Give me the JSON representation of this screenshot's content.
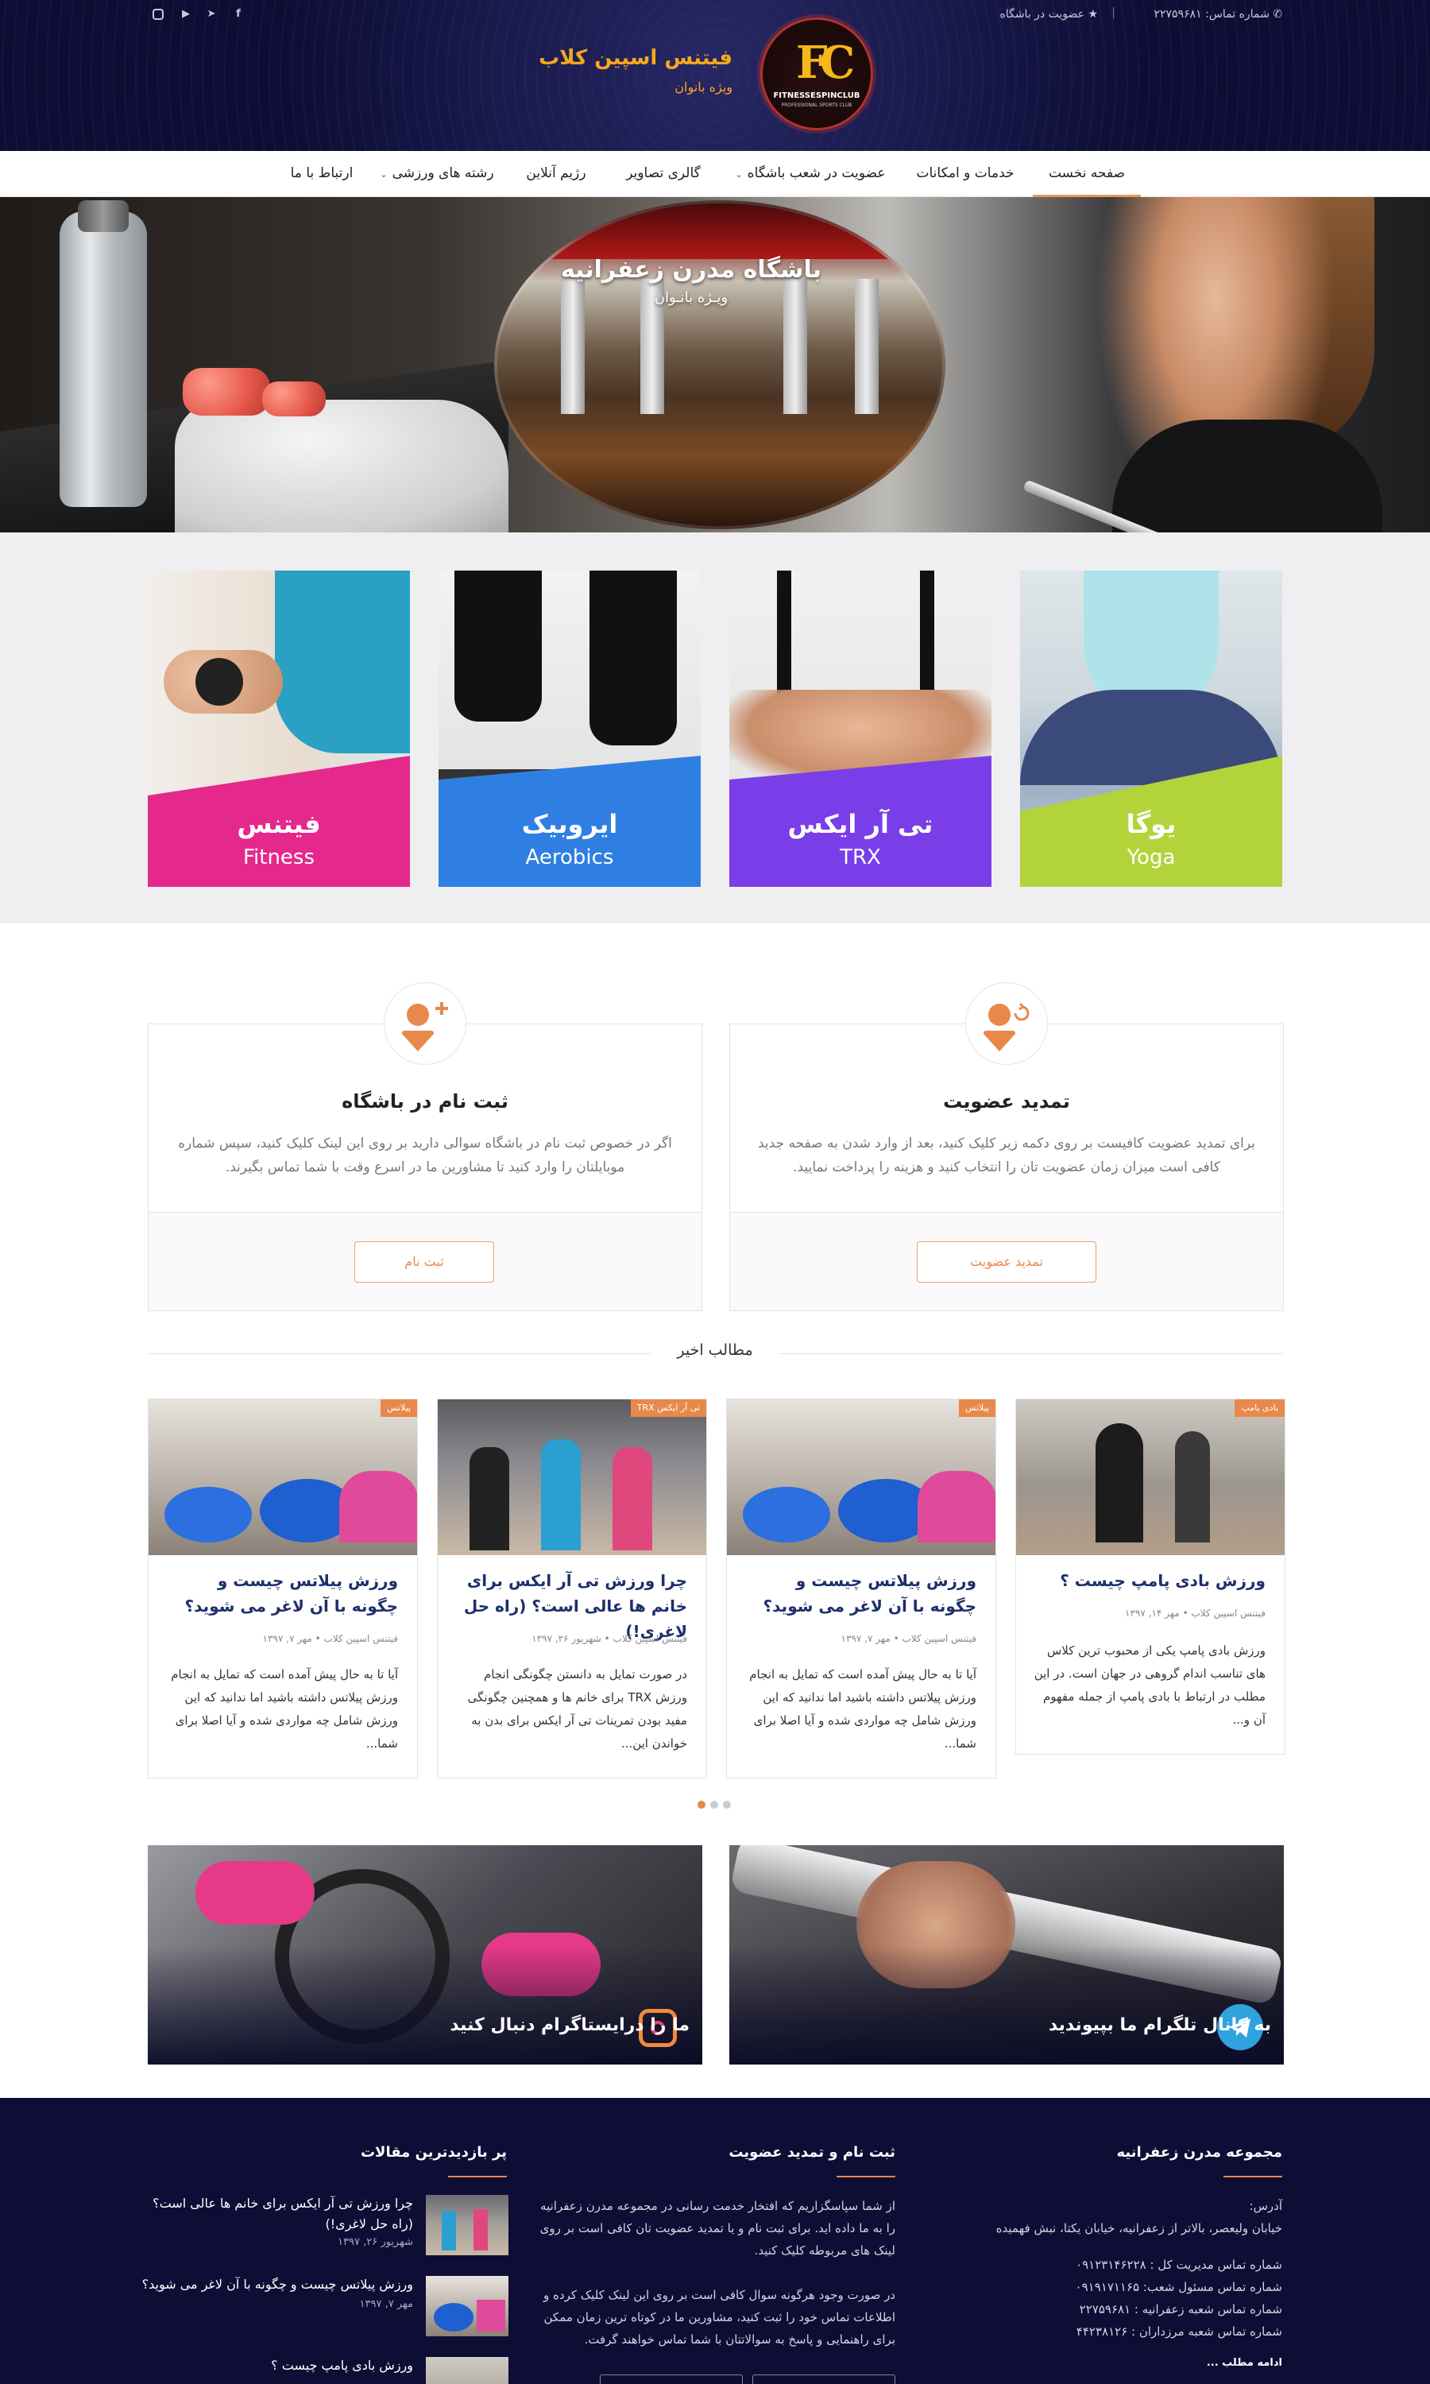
{
  "topbar": {
    "phone_label": "شماره تماس: ۲۲۷۵۹۶۸۱",
    "membership_link": "عضویت در باشگاه"
  },
  "brand": {
    "title": "فیتنس اسپین کلاب",
    "subtitle": "ویژه بانوان",
    "logo_letters": "FC",
    "logo_word": "FITNESSESPINCLUB",
    "logo_tagline": "PROFESSIONAL SPORTS CLUB"
  },
  "nav": {
    "items": [
      {
        "label": "صفحه نخست"
      },
      {
        "label": "خدمات و امکانات"
      },
      {
        "label": "عضویت در شعب باشگاه"
      },
      {
        "label": "گالری تصاویر"
      },
      {
        "label": "رژیم آنلاین"
      },
      {
        "label": "رشته های ورزشی"
      },
      {
        "label": "ارتباط با ما"
      }
    ]
  },
  "hero": {
    "title": "باشگاه مدرن زعفرانیه",
    "subtitle": "ویـژه بانـوان"
  },
  "categories": [
    {
      "fa": "فیتنس",
      "en": "Fitness",
      "color": "#e5288c"
    },
    {
      "fa": "ایروبیک",
      "en": "Aerobics",
      "color": "#2f7fe3"
    },
    {
      "fa": "تی آر ایکس",
      "en": "TRX",
      "color": "#7a3ee8"
    },
    {
      "fa": "یوگا",
      "en": "Yoga",
      "color": "#b3d33a"
    }
  ],
  "membership": {
    "register": {
      "title": "ثبت نام در باشگاه",
      "desc": "اگر در خصوص ثبت نام در باشگاه سوالی دارید بر روی این لینک کلیک کنید، سپس شماره موبایلتان را وارد کنید تا مشاورین ما در اسرع وقت با شما تماس بگیرند.",
      "button": "ثبت نام"
    },
    "renew": {
      "title": "تمدید عضویت",
      "desc": "برای تمدید عضویت کافیست بر روی دکمه زیر کلیک کنید، بعد از وارد شدن به صفحه جدید کافی است میزان زمان عضویت تان را انتخاب کنید و هزینه را پرداخت نمایید.",
      "button": "تمدید عضویت"
    }
  },
  "recent": {
    "title": "مطالب اخیر",
    "posts": [
      {
        "tag": "بادی پامپ",
        "title": "ورزش بادی پامپ چیست ؟",
        "author": "فیتنس اسپین کلاب",
        "date": "مهر ۱۴, ۱۳۹۷",
        "excerpt": "ورزش بادی پامپ یکی از محبوب ترین کلاس های تناسب اندام گروهی در جهان است. در این مطلب در ارتباط با بادی پامپ از جمله مفهوم آن و..."
      },
      {
        "tag": "پیلاتس",
        "title": "ورزش پیلاتس چیست و چگونه با آن لاغر می شوید؟",
        "author": "فیتنس اسپین کلاب",
        "date": "مهر ۷, ۱۳۹۷",
        "excerpt": "آیا تا به حال پیش آمده است که تمایل به انجام ورزش پیلاتس داشته باشید اما ندانید که این ورزش شامل چه مواردی شده و آیا اصلا برای شما..."
      },
      {
        "tag": "تی آر ایکس TRX",
        "title": "چرا ورزش تی آر ایکس برای خانم ها عالی است؟ (راه حل لاغری!)",
        "author": "فیتنس اسپین کلاب",
        "date": "شهریور ۲۶, ۱۳۹۷",
        "excerpt": "در صورت تمایل به دانستن چگونگی انجام ورزش TRX برای خانم ها و همچنین چگونگی مفید بودن تمرینات تی آر ایکس برای بدن به خواندن این..."
      },
      {
        "tag": "پیلاتس",
        "title": "ورزش پیلاتس چیست و چگونه با آن لاغر می شوید؟",
        "author": "فیتنس اسپین کلاب",
        "date": "مهر ۷, ۱۳۹۷",
        "excerpt": "آیا تا به حال پیش آمده است که تمایل به انجام ورزش پیلاتس داشته باشید اما ندانید که این ورزش شامل چه مواردی شده و آیا اصلا برای شما..."
      }
    ]
  },
  "banners": {
    "telegram": "به کانال تلگرام ما بپیوندید",
    "instagram": "ما را درایستاگرام دنبال کنید"
  },
  "footer": {
    "about": {
      "title": "مجموعه مدرن زعفرانیه",
      "address_label": "آدرس:",
      "address": "خیابان ولیعصر، بالاتر از زعفرانیه، خیابان یکتا، نبش فهمیده",
      "lines": [
        "شماره تماس مدیریت کل : ۰۹۱۲۳۱۴۶۲۲۸",
        "شماره تماس مسئول شعب: ۰۹۱۹۱۷۱۱۶۵",
        "شماره تماس شعبه زعفرانیه : ۲۲۷۵۹۶۸۱",
        "شماره تماس شعبه مرزداران : ۴۴۲۳۸۱۲۶"
      ],
      "more": "ادامه مطلب ..."
    },
    "signup": {
      "title": "ثبت نام و تمدید عضویت",
      "p1": "از شما سپاسگزاریم که افتخار خدمت رسانی در مجموعه مدرن زعفرانیه را به ما داده اید. برای ثبت نام و یا تمدید عضویت تان کافی است بر روی لینک های مربوطه کلیک کنید.",
      "p2": "در صورت وجود هرگونه سوال کافی است بر روی این لینک کلیک کرده و اطلاعات تماس خود را ثبت کنید، مشاورین ما در کوتاه ترین زمان ممکن برای راهنمایی و پاسخ به سوالاتتان با شما تماس خواهند گرفت."
    },
    "popular": {
      "title": "پر بازدیدترین مقالات",
      "items": [
        {
          "title": "چرا ورزش تی آر ایکس برای خانم ها عالی است؟ (راه حل لاغری!)",
          "date": "شهریور ۲۶, ۱۳۹۷"
        },
        {
          "title": "ورزش پیلاتس چیست و چگونه با آن لاغر می شوید؟",
          "date": "مهر ۷, ۱۳۹۷"
        },
        {
          "title": "ورزش بادی پامپ چیست ؟",
          "date": ""
        }
      ]
    }
  },
  "colors": {
    "navy": "#0d0d35",
    "accent": "#e8884a",
    "gold": "#f4a81d"
  }
}
